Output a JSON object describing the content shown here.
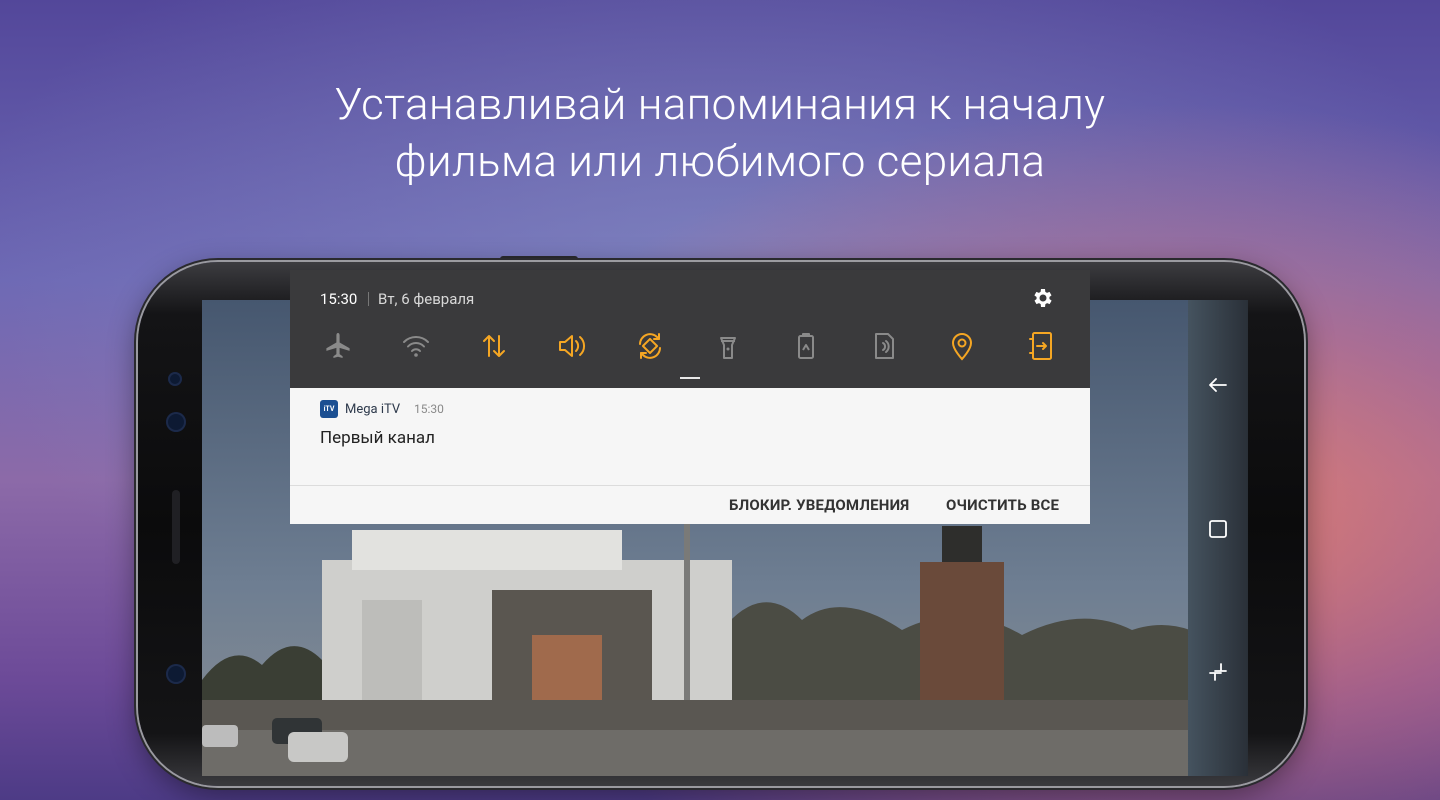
{
  "headline": {
    "line1": "Устанавливай напоминания к началу",
    "line2": "фильма или любимого сериала"
  },
  "status": {
    "time": "15:30",
    "date": "Вт, 6 февраля"
  },
  "quick_settings": [
    {
      "name": "airplane-mode-icon",
      "active": false
    },
    {
      "name": "wifi-icon",
      "active": false
    },
    {
      "name": "mobile-data-icon",
      "active": true
    },
    {
      "name": "sound-icon",
      "active": true
    },
    {
      "name": "auto-rotate-icon",
      "active": true
    },
    {
      "name": "flashlight-icon",
      "active": false
    },
    {
      "name": "power-saving-icon",
      "active": false
    },
    {
      "name": "nfc-icon",
      "active": false
    },
    {
      "name": "location-icon",
      "active": true
    },
    {
      "name": "secure-folder-icon",
      "active": true
    }
  ],
  "notification": {
    "app_name": "Mega iTV",
    "app_icon_text": "iTV",
    "time": "15:30",
    "title": "Первый канал"
  },
  "actions": {
    "block": "БЛОКИР. УВЕДОМЛЕНИЯ",
    "clear_all": "ОЧИСТИТЬ ВСЕ"
  },
  "colors": {
    "active_icon": "#f5a623",
    "inactive_icon": "#8a8a8a",
    "shade_bg": "#3a3a3c",
    "card_bg": "#f6f6f6",
    "app_accent": "#1b4f92"
  }
}
